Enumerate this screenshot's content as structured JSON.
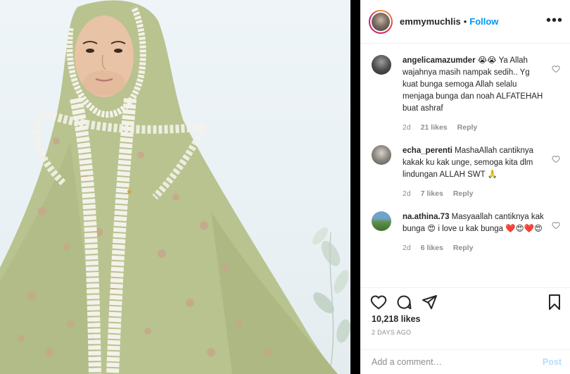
{
  "photo": {
    "alt_subject": "woman-in-green-floral-prayer-robe"
  },
  "header": {
    "username": "emmymuchlis",
    "separator": "•",
    "follow_label": "Follow",
    "more_icon": "more-options-icon"
  },
  "comments": [
    {
      "user": "angelicamazumder",
      "text": "😭😭 Ya Allah wajahnya masih nampak sedih.. Yg kuat bunga semoga Allah selalu menjaga bunga dan noah ALFATEHAH buat ashraf",
      "age": "2d",
      "likes": "21 likes",
      "reply": "Reply",
      "avatar_color": "#4a4a4a"
    },
    {
      "user": "echa_perenti",
      "text": "MashaAllah cantiknya kakak ku kak unge, semoga kita dlm lindungan ALLAH SWT 🙏",
      "age": "2d",
      "likes": "7 likes",
      "reply": "Reply",
      "avatar_color": "#8a8680"
    },
    {
      "user": "na.athina.73",
      "text": "Masyaallah cantiknya kak bunga 😍 i love u kak bunga ❤️😍❤️😍",
      "age": "2d",
      "likes": "6 likes",
      "reply": "Reply",
      "avatar_color": "#5f8e4a"
    }
  ],
  "actions": {
    "like_icon": "heart-icon",
    "comment_icon": "comment-icon",
    "share_icon": "share-icon",
    "save_icon": "bookmark-icon"
  },
  "stats": {
    "likes": "10,218 likes",
    "time_ago": "2 DAYS AGO"
  },
  "add_comment": {
    "placeholder": "Add a comment…",
    "post_label": "Post"
  },
  "colors": {
    "accent": "#0095f6",
    "post_disabled": "#b2dffc",
    "robe_green": "#b8c38f",
    "lace_white": "#f4f2ea"
  }
}
